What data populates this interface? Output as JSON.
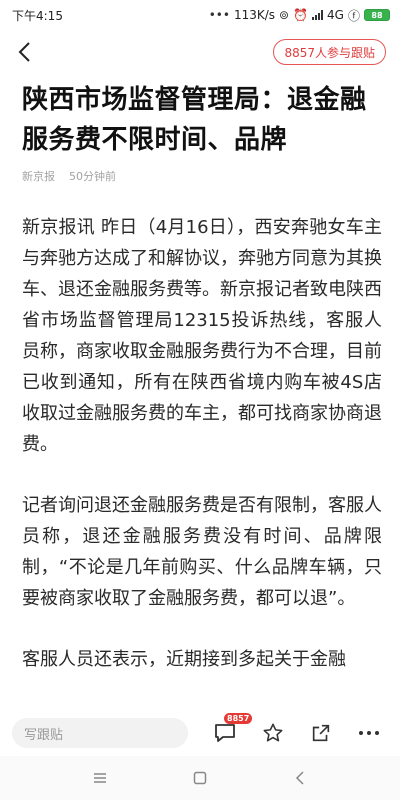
{
  "status_bar": {
    "time": "下午4:15",
    "dots": "•••",
    "speed": "113K/s",
    "network": "4G",
    "battery": "88"
  },
  "header": {
    "join_label": "8857人参与跟贴"
  },
  "article": {
    "title": "陕西市场监督管理局：退金融服务费不限时间、品牌",
    "source": "新京报",
    "time": "50分钟前",
    "paragraphs": [
      "新京报讯 昨日（4月16日），西安奔驰女车主与奔驰方达成了和解协议，奔驰方同意为其换车、退还金融服务费等。新京报记者致电陕西省市场监督管理局12315投诉热线，客服人员称，商家收取金融服务费行为不合理，目前已收到通知，所有在陕西省境内购车被4S店收取过金融服务费的车主，都可找商家协商退费。",
      "记者询问退还金融服务费是否有限制，客服人员称，退还金融服务费没有时间、品牌限制，“不论是几年前购买、什么品牌车辆，只要被商家收取了金融服务费，都可以退”。",
      "客服人员还表示，近期接到多起关于金融"
    ]
  },
  "bottom_bar": {
    "comment_placeholder": "写跟贴",
    "comment_count": "8857"
  },
  "colors": {
    "accent": "#e03c3c",
    "battery": "#37b24d"
  }
}
